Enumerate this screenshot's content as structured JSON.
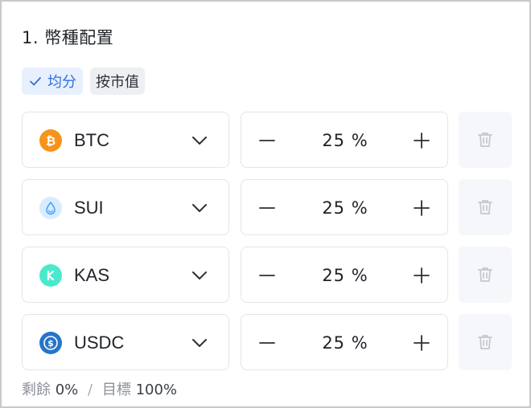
{
  "section": {
    "title": "1. 幣種配置"
  },
  "modes": [
    {
      "label": "均分",
      "active": true,
      "icon": "check-icon"
    },
    {
      "label": "按市值",
      "active": false
    }
  ],
  "rows": [
    {
      "coin": "BTC",
      "icon": "bitcoin-icon",
      "color": "#f7931a",
      "percent": "25 %"
    },
    {
      "coin": "SUI",
      "icon": "sui-droplet-icon",
      "color": "#4da2ff",
      "percent": "25 %"
    },
    {
      "coin": "KAS",
      "icon": "kaspa-icon",
      "color": "#49eacb",
      "percent": "25 %"
    },
    {
      "coin": "USDC",
      "icon": "usdc-icon",
      "color": "#2775ca",
      "percent": "25 %"
    }
  ],
  "footer": {
    "remaining_label": "剩餘",
    "remaining_value": "0%",
    "separator": "/",
    "target_label": "目標",
    "target_value": "100%"
  },
  "colors": {
    "accent": "#2f6fe0",
    "chip_active_bg": "#e8f0fe",
    "border": "#e3e5e9",
    "delete_bg": "#f5f7fa"
  }
}
